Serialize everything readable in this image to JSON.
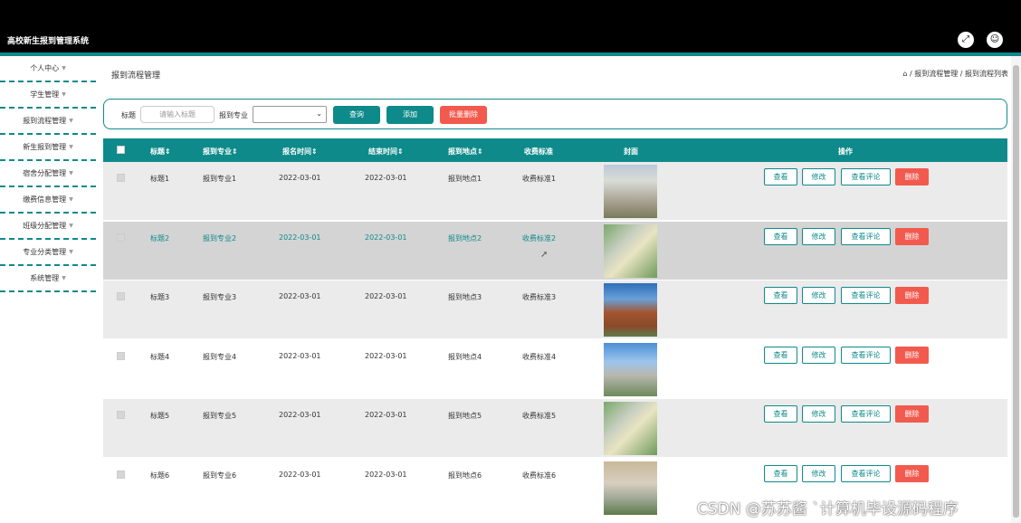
{
  "app": {
    "title": "高校新生报到管理系统"
  },
  "header_icons": [
    {
      "name": "fullscreen-icon",
      "glyph": "⤢"
    },
    {
      "name": "user-icon",
      "glyph": "☺"
    }
  ],
  "sidebar": {
    "items": [
      {
        "label": "个人中心"
      },
      {
        "label": "学生管理"
      },
      {
        "label": "报到流程管理"
      },
      {
        "label": "新生报到管理"
      },
      {
        "label": "宿舍分配管理"
      },
      {
        "label": "缴费信息管理"
      },
      {
        "label": "班级分配管理"
      },
      {
        "label": "专业分类管理"
      },
      {
        "label": "系统管理"
      }
    ],
    "arrow": "▼"
  },
  "page": {
    "title": "报到流程管理",
    "home_icon": "⌂",
    "breadcrumb": "/ 报到流程管理 / 报到流程列表"
  },
  "search": {
    "title_label": "标题",
    "title_placeholder": "请输入标题",
    "major_label": "报到专业",
    "major_value": "",
    "query_button": "查询",
    "add_button": "添加",
    "batch_delete_button": "批量删除"
  },
  "table": {
    "headers": [
      "标题⇕",
      "报到专业⇕",
      "报名时间⇕",
      "结束时间⇕",
      "报到地点⇕",
      "收费标准",
      "封面",
      "操作"
    ],
    "rows": [
      {
        "title": "标题1",
        "major": "报到专业1",
        "start": "2022-03-01",
        "end": "2022-03-01",
        "place": "报到地点1",
        "fee": "收费标准1"
      },
      {
        "title": "标题2",
        "major": "报到专业2",
        "start": "2022-03-01",
        "end": "2022-03-01",
        "place": "报到地点2",
        "fee": "收费标准2"
      },
      {
        "title": "标题3",
        "major": "报到专业3",
        "start": "2022-03-01",
        "end": "2022-03-01",
        "place": "报到地点3",
        "fee": "收费标准3"
      },
      {
        "title": "标题4",
        "major": "报到专业4",
        "start": "2022-03-01",
        "end": "2022-03-01",
        "place": "报到地点4",
        "fee": "收费标准4"
      },
      {
        "title": "标题5",
        "major": "报到专业5",
        "start": "2022-03-01",
        "end": "2022-03-01",
        "place": "报到地点5",
        "fee": "收费标准5"
      },
      {
        "title": "标题6",
        "major": "报到专业6",
        "start": "2022-03-01",
        "end": "2022-03-01",
        "place": "报到地点6",
        "fee": "收费标准6"
      }
    ],
    "actions": {
      "view": "查看",
      "edit": "修改",
      "comments": "查看评论",
      "delete": "删除"
    }
  },
  "watermark": "CSDN @苏苏酱 `计算机毕设源码程序",
  "colors": {
    "accent": "#0f8a8a",
    "danger": "#f25a4e",
    "header": "#000000"
  }
}
